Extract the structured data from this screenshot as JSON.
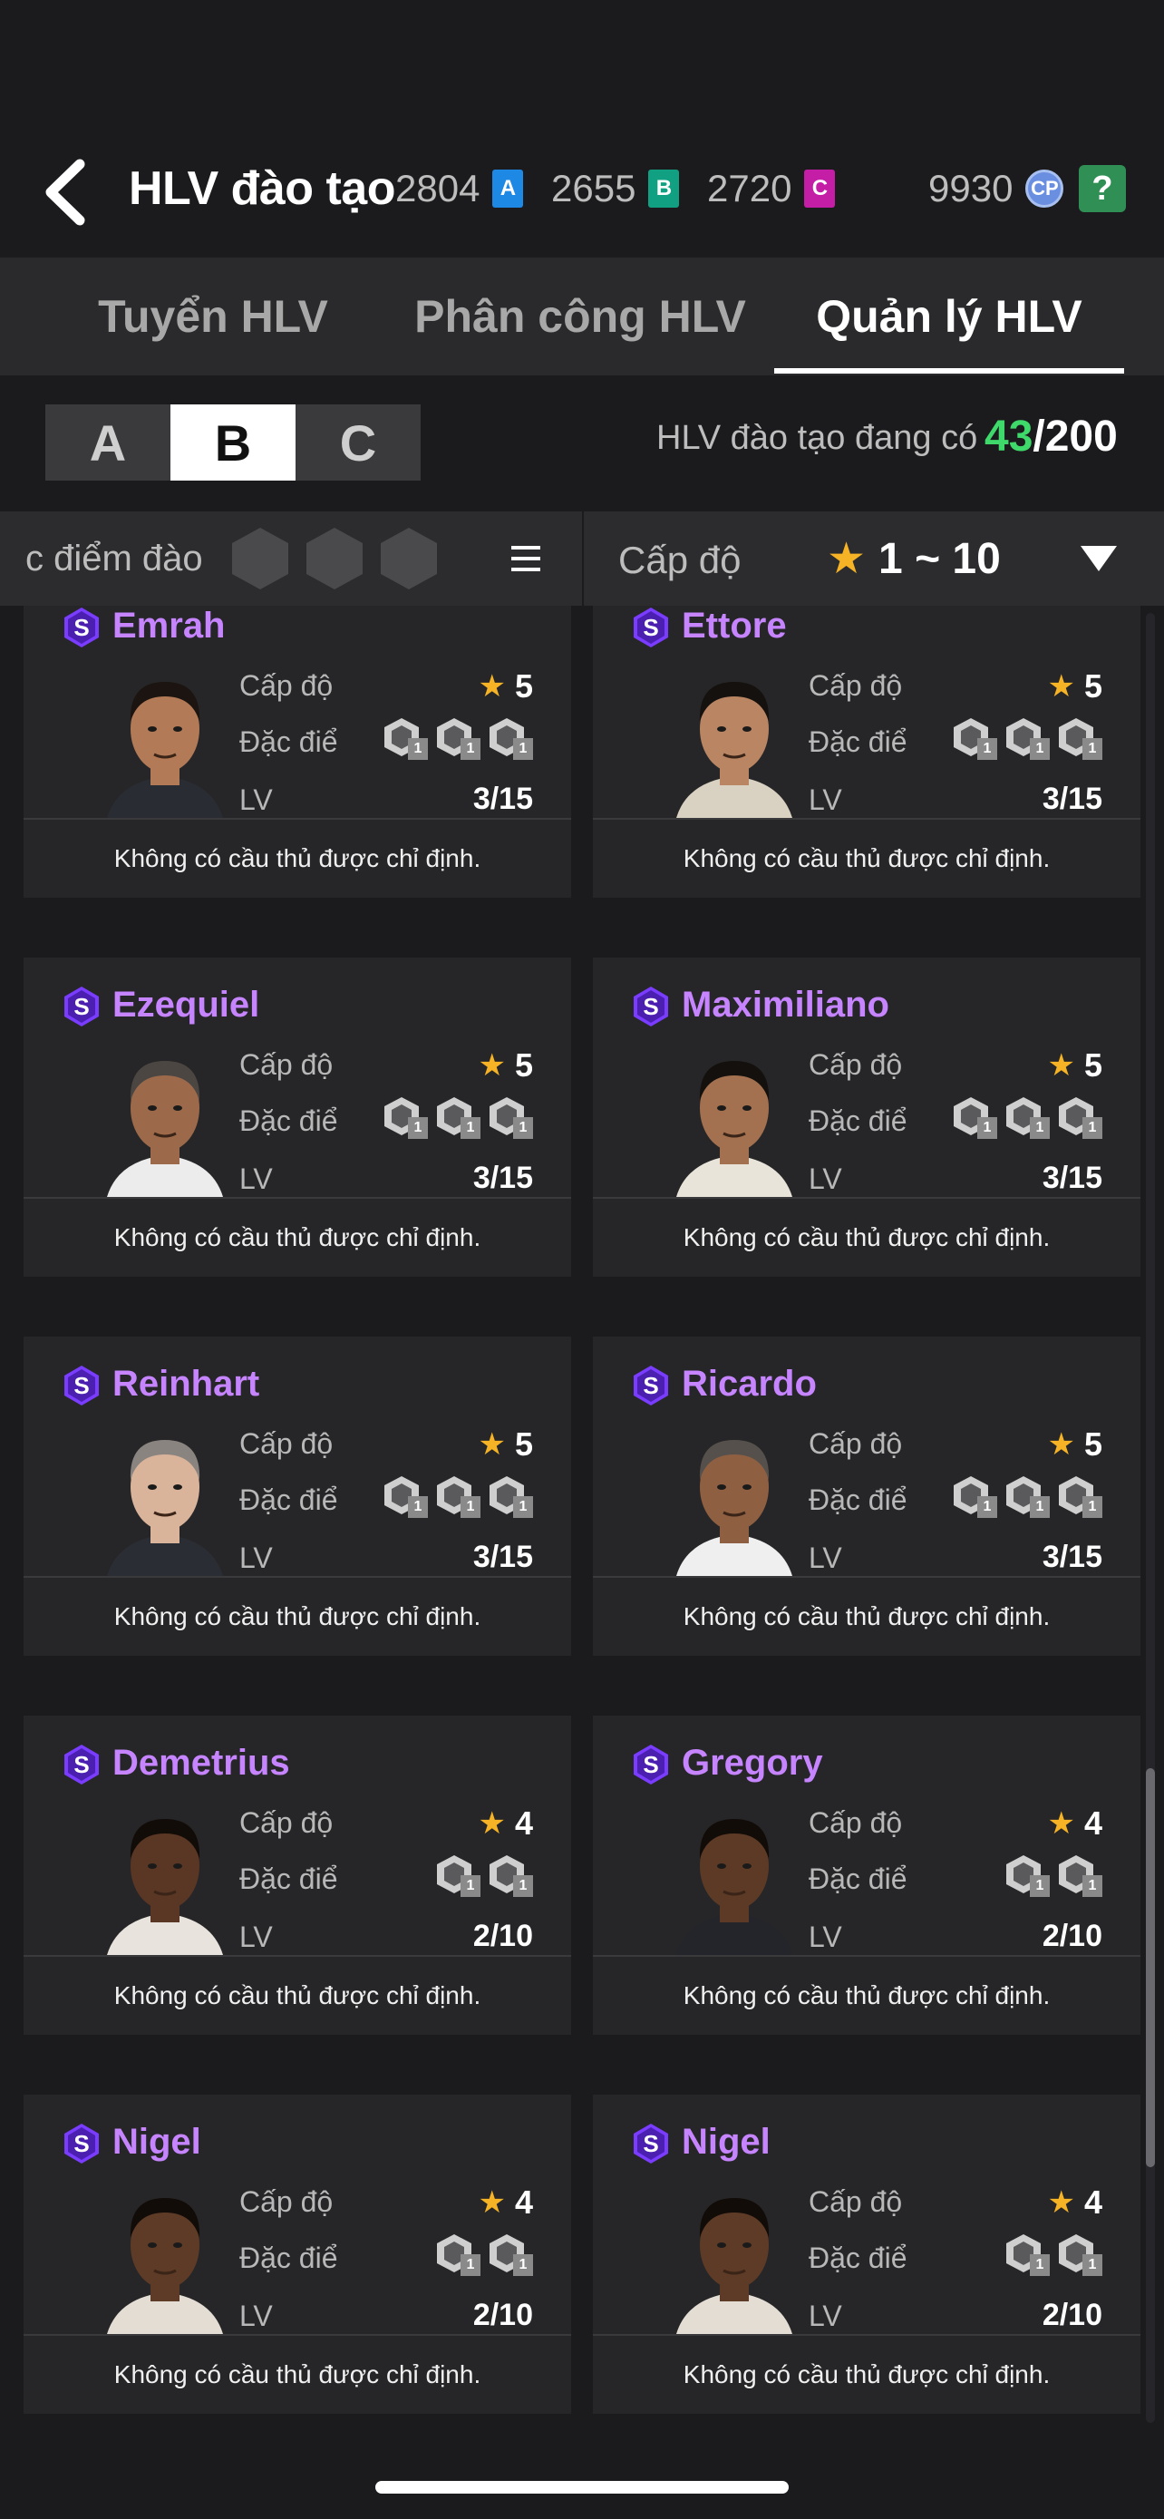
{
  "header": {
    "title": "HLV đào tạo",
    "currencies": [
      {
        "value": "2804",
        "letter": "A",
        "color": "#1e88e5"
      },
      {
        "value": "2655",
        "letter": "B",
        "color": "#12a082"
      },
      {
        "value": "2720",
        "letter": "C",
        "color": "#c41ea6"
      }
    ],
    "cp_value": "9930",
    "cp_label": "CP",
    "help_label": "?"
  },
  "tabs": [
    {
      "label": "Tuyển HLV",
      "active": false
    },
    {
      "label": "Phân công HLV",
      "active": false
    },
    {
      "label": "Quản lý HLV",
      "active": true
    }
  ],
  "grades": [
    {
      "label": "A",
      "active": false
    },
    {
      "label": "B",
      "active": true
    },
    {
      "label": "C",
      "active": false
    }
  ],
  "count": {
    "label": "HLV đào tạo đang có",
    "current": "43",
    "max": "/200"
  },
  "filter": {
    "trait_label": "c điểm đào",
    "level_label": "Cấp độ",
    "level_range": "1 ~ 10"
  },
  "card_labels": {
    "level": "Cấp độ",
    "trait": "Đặc điểm",
    "lv": "LV",
    "footer": "Không có cầu thủ được chỉ định."
  },
  "coaches": [
    {
      "name": "Emrah",
      "stars": "5",
      "lv": "3/15",
      "traits": [
        "1",
        "1",
        "1"
      ],
      "skin": "#b27a56",
      "hair": "#1b1410",
      "shirt": "#2a2c33"
    },
    {
      "name": "Ettore",
      "stars": "5",
      "lv": "3/15",
      "traits": [
        "1",
        "1",
        "1"
      ],
      "skin": "#b98563",
      "hair": "#15110e",
      "shirt": "#d9d2c3"
    },
    {
      "name": "Ezequiel",
      "stars": "5",
      "lv": "3/15",
      "traits": [
        "1",
        "1",
        "1"
      ],
      "skin": "#9c6a4a",
      "hair": "#4b4642",
      "shirt": "#ececec"
    },
    {
      "name": "Maximiliano",
      "stars": "5",
      "lv": "3/15",
      "traits": [
        "1",
        "1",
        "1"
      ],
      "skin": "#a3714f",
      "hair": "#14100d",
      "shirt": "#e9e4da"
    },
    {
      "name": "Reinhart",
      "stars": "5",
      "lv": "3/15",
      "traits": [
        "1",
        "1",
        "1"
      ],
      "skin": "#d9b39a",
      "hair": "#8a8480",
      "shirt": "#2b2d34"
    },
    {
      "name": "Ricardo",
      "stars": "5",
      "lv": "3/15",
      "traits": [
        "1",
        "1",
        "1"
      ],
      "skin": "#8f5f42",
      "hair": "#55504b",
      "shirt": "#efefef"
    },
    {
      "name": "Demetrius",
      "stars": "4",
      "lv": "2/10",
      "traits": [
        "1",
        "1"
      ],
      "skin": "#5a3624",
      "hair": "#120c09",
      "shirt": "#e8e3dc"
    },
    {
      "name": "Gregory",
      "stars": "4",
      "lv": "2/10",
      "traits": [
        "1",
        "1"
      ],
      "skin": "#5c3a26",
      "hair": "#120c09",
      "shirt": "#23252b"
    },
    {
      "name": "Nigel",
      "stars": "4",
      "lv": "2/10",
      "traits": [
        "1",
        "1"
      ],
      "skin": "#5e3b26",
      "hair": "#120c09",
      "shirt": "#e3ddd4"
    },
    {
      "name": "Nigel",
      "stars": "4",
      "lv": "2/10",
      "traits": [
        "1",
        "1"
      ],
      "skin": "#5e3b26",
      "hair": "#120c09",
      "shirt": "#e3ddd4"
    }
  ]
}
